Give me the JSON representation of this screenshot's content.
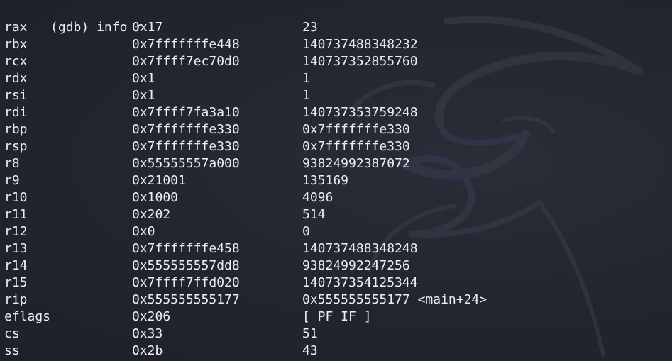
{
  "terminal": {
    "top_fragment": {
      "left": "",
      "red": ""
    },
    "prompt": "(gdb)",
    "command": "info r",
    "registers": [
      {
        "name": "rax",
        "hex": "0x17",
        "value": "23"
      },
      {
        "name": "rbx",
        "hex": "0x7fffffffe448",
        "value": "140737488348232"
      },
      {
        "name": "rcx",
        "hex": "0x7ffff7ec70d0",
        "value": "140737352855760"
      },
      {
        "name": "rdx",
        "hex": "0x1",
        "value": "1"
      },
      {
        "name": "rsi",
        "hex": "0x1",
        "value": "1"
      },
      {
        "name": "rdi",
        "hex": "0x7ffff7fa3a10",
        "value": "140737353759248"
      },
      {
        "name": "rbp",
        "hex": "0x7fffffffe330",
        "value": "0x7fffffffe330"
      },
      {
        "name": "rsp",
        "hex": "0x7fffffffe330",
        "value": "0x7fffffffe330"
      },
      {
        "name": "r8",
        "hex": "0x55555557a000",
        "value": "93824992387072"
      },
      {
        "name": "r9",
        "hex": "0x21001",
        "value": "135169"
      },
      {
        "name": "r10",
        "hex": "0x1000",
        "value": "4096"
      },
      {
        "name": "r11",
        "hex": "0x202",
        "value": "514"
      },
      {
        "name": "r12",
        "hex": "0x0",
        "value": "0"
      },
      {
        "name": "r13",
        "hex": "0x7fffffffe458",
        "value": "140737488348248"
      },
      {
        "name": "r14",
        "hex": "0x555555557dd8",
        "value": "93824992247256"
      },
      {
        "name": "r15",
        "hex": "0x7ffff7ffd020",
        "value": "140737354125344"
      },
      {
        "name": "rip",
        "hex": "0x555555555177",
        "value": "0x555555555177 <main+24>"
      },
      {
        "name": "eflags",
        "hex": "0x206",
        "value": "[ PF IF ]"
      },
      {
        "name": "cs",
        "hex": "0x33",
        "value": "51"
      },
      {
        "name": "ss",
        "hex": "0x2b",
        "value": "43"
      }
    ]
  },
  "colors": {
    "background": "#23252e",
    "text": "#eceff1",
    "watermark": "#3a3e4a"
  },
  "icons": {
    "watermark": "kali-dragon-logo"
  }
}
